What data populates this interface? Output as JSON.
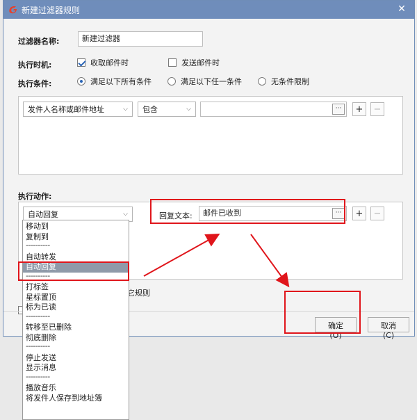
{
  "window": {
    "title": "新建过滤器规则"
  },
  "filter_name": {
    "label": "过滤器名称:",
    "value": "新建过滤器"
  },
  "exec_time": {
    "label": "执行时机:",
    "options": [
      {
        "label": "收取邮件时",
        "checked": true
      },
      {
        "label": "发送邮件时",
        "checked": false
      }
    ]
  },
  "exec_condition": {
    "label": "执行条件:",
    "options": [
      {
        "label": "满足以下所有条件",
        "checked": true
      },
      {
        "label": "满足以下任一条件",
        "checked": false
      },
      {
        "label": "无条件限制",
        "checked": false
      }
    ]
  },
  "condition_row": {
    "field": "发件人名称或邮件地址",
    "operator": "包含",
    "value": ""
  },
  "exec_action": {
    "label": "执行动作:",
    "selected": "自动回复",
    "reply_label": "回复文本:",
    "reply_value": "邮件已收到"
  },
  "dropdown": {
    "items": [
      "移动到",
      "复制到",
      "----------",
      "自动转发",
      "自动回复",
      "----------",
      "打标签",
      "星标置顶",
      "标为已读",
      "----------",
      "转移至已删除",
      "彻底删除",
      "----------",
      "停止发送",
      "显示消息",
      "----------",
      "播放音乐",
      "将发件人保存到地址簿"
    ],
    "selected_index": 4
  },
  "stop_rule_text": "它规则",
  "buttons": {
    "ok": "确定(O)",
    "cancel": "取消(C)"
  },
  "symbols": {
    "ellipsis": "···",
    "plus": "+",
    "minus": "−",
    "close": "✕",
    "chevron": "⌵"
  },
  "colors": {
    "titlebar": "#6f8dbb",
    "highlight": "#e0151b",
    "selected_item": "#8f9aa9"
  }
}
